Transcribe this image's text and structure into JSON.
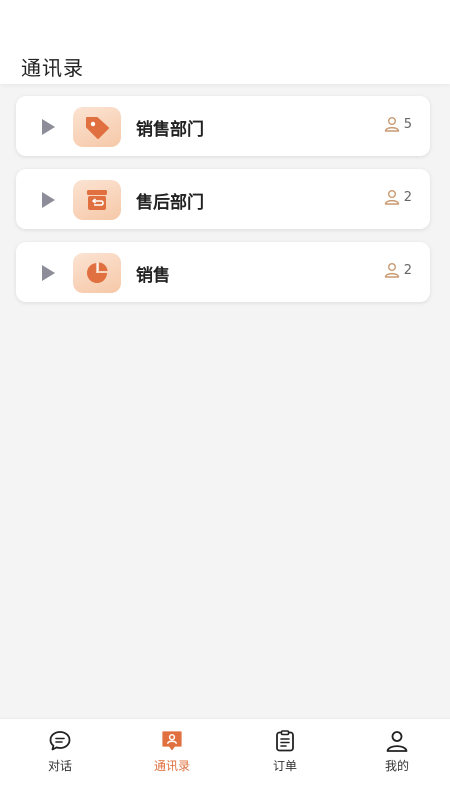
{
  "header": {
    "title": "通讯录"
  },
  "departments": [
    {
      "name": "销售部门",
      "member_count": "5",
      "icon": "price-tag-icon"
    },
    {
      "name": "售后部门",
      "member_count": "2",
      "icon": "return-box-icon"
    },
    {
      "name": "销售",
      "member_count": "2",
      "icon": "pie-chart-icon"
    }
  ],
  "tabbar": {
    "items": [
      {
        "label": "对话",
        "icon": "chat-bubble-icon",
        "active": false
      },
      {
        "label": "通讯录",
        "icon": "contacts-book-icon",
        "active": true
      },
      {
        "label": "订单",
        "icon": "clipboard-icon",
        "active": false
      },
      {
        "label": "我的",
        "icon": "user-icon",
        "active": false
      }
    ]
  },
  "colors": {
    "accent": "#e0703f",
    "icon_bg_light": "#fbe3d2",
    "arrow_gray": "#8d8d99",
    "person_icon": "#c99a72",
    "background": "#f4f4f4"
  }
}
